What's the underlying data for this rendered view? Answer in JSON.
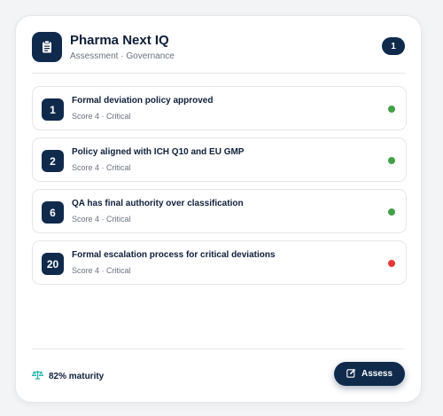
{
  "header": {
    "title": "Pharma Next IQ",
    "subtitle": "Assessment · Governance",
    "count": "1",
    "icon": "clipboard-icon"
  },
  "items": [
    {
      "number": "1",
      "title": "Formal deviation policy approved",
      "meta": "Score 4 · Critical",
      "status": "ok",
      "status_color": "#43a047"
    },
    {
      "number": "2",
      "title": "Policy aligned with ICH Q10 and EU GMP",
      "meta": "Score 4 · Critical",
      "status": "ok",
      "status_color": "#43a047"
    },
    {
      "number": "6",
      "title": "QA has final authority over classification",
      "meta": "Score 4 · Critical",
      "status": "ok",
      "status_color": "#43a047"
    },
    {
      "number": "20",
      "title": "Formal escalation process for critical deviations",
      "meta": "Score 4 · Critical",
      "status": "fail",
      "status_color": "#e53935"
    }
  ],
  "footer": {
    "maturity": "82% maturity",
    "maturity_icon": "scale-icon",
    "assess_label": "Assess",
    "assess_icon": "edit-icon"
  },
  "colors": {
    "primary": "#102a4c",
    "accent": "#1ab3a6",
    "ok": "#43a047",
    "fail": "#e53935"
  }
}
